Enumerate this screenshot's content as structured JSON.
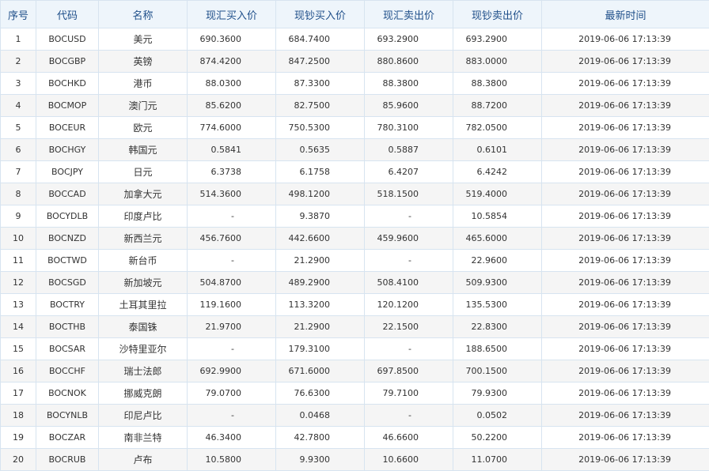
{
  "columns": [
    "序号",
    "代码",
    "名称",
    "现汇买入价",
    "现钞买入价",
    "现汇卖出价",
    "现钞卖出价",
    "最新时间"
  ],
  "rows": [
    [
      "1",
      "BOCUSD",
      "美元",
      "690.3600",
      "684.7400",
      "693.2900",
      "693.2900",
      "2019-06-06 17:13:39"
    ],
    [
      "2",
      "BOCGBP",
      "英镑",
      "874.4200",
      "847.2500",
      "880.8600",
      "883.0000",
      "2019-06-06 17:13:39"
    ],
    [
      "3",
      "BOCHKD",
      "港币",
      "88.0300",
      "87.3300",
      "88.3800",
      "88.3800",
      "2019-06-06 17:13:39"
    ],
    [
      "4",
      "BOCMOP",
      "澳门元",
      "85.6200",
      "82.7500",
      "85.9600",
      "88.7200",
      "2019-06-06 17:13:39"
    ],
    [
      "5",
      "BOCEUR",
      "欧元",
      "774.6000",
      "750.5300",
      "780.3100",
      "782.0500",
      "2019-06-06 17:13:39"
    ],
    [
      "6",
      "BOCHGY",
      "韩国元",
      "0.5841",
      "0.5635",
      "0.5887",
      "0.6101",
      "2019-06-06 17:13:39"
    ],
    [
      "7",
      "BOCJPY",
      "日元",
      "6.3738",
      "6.1758",
      "6.4207",
      "6.4242",
      "2019-06-06 17:13:39"
    ],
    [
      "8",
      "BOCCAD",
      "加拿大元",
      "514.3600",
      "498.1200",
      "518.1500",
      "519.4000",
      "2019-06-06 17:13:39"
    ],
    [
      "9",
      "BOCYDLB",
      "印度卢比",
      "-",
      "9.3870",
      "-",
      "10.5854",
      "2019-06-06 17:13:39"
    ],
    [
      "10",
      "BOCNZD",
      "新西兰元",
      "456.7600",
      "442.6600",
      "459.9600",
      "465.6000",
      "2019-06-06 17:13:39"
    ],
    [
      "11",
      "BOCTWD",
      "新台币",
      "-",
      "21.2900",
      "-",
      "22.9600",
      "2019-06-06 17:13:39"
    ],
    [
      "12",
      "BOCSGD",
      "新加坡元",
      "504.8700",
      "489.2900",
      "508.4100",
      "509.9300",
      "2019-06-06 17:13:39"
    ],
    [
      "13",
      "BOCTRY",
      "土耳其里拉",
      "119.1600",
      "113.3200",
      "120.1200",
      "135.5300",
      "2019-06-06 17:13:39"
    ],
    [
      "14",
      "BOCTHB",
      "泰国铢",
      "21.9700",
      "21.2900",
      "22.1500",
      "22.8300",
      "2019-06-06 17:13:39"
    ],
    [
      "15",
      "BOCSAR",
      "沙特里亚尔",
      "-",
      "179.3100",
      "-",
      "188.6500",
      "2019-06-06 17:13:39"
    ],
    [
      "16",
      "BOCCHF",
      "瑞士法郎",
      "692.9900",
      "671.6000",
      "697.8500",
      "700.1500",
      "2019-06-06 17:13:39"
    ],
    [
      "17",
      "BOCNOK",
      "挪威克朗",
      "79.0700",
      "76.6300",
      "79.7100",
      "79.9300",
      "2019-06-06 17:13:39"
    ],
    [
      "18",
      "BOCYNLB",
      "印尼卢比",
      "-",
      "0.0468",
      "-",
      "0.0502",
      "2019-06-06 17:13:39"
    ],
    [
      "19",
      "BOCZAR",
      "南非兰特",
      "46.3400",
      "42.7800",
      "46.6600",
      "50.2200",
      "2019-06-06 17:13:39"
    ],
    [
      "20",
      "BOCRUB",
      "卢布",
      "10.5800",
      "9.9300",
      "10.6600",
      "11.0700",
      "2019-06-06 17:13:39"
    ]
  ]
}
